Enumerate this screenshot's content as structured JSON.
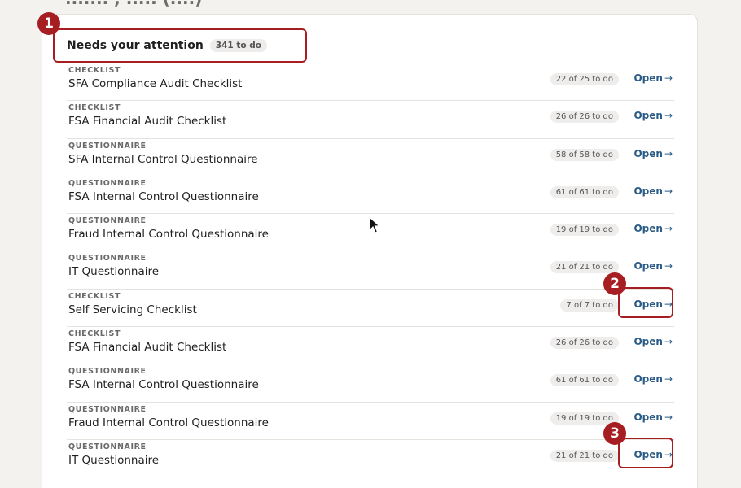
{
  "page": {
    "heading_cut": "....... , ..... (....)"
  },
  "section": {
    "title": "Needs your attention",
    "count_badge": "341 to do"
  },
  "open_label": "Open",
  "items": [
    {
      "type": "CHECKLIST",
      "name": "SFA Compliance Audit Checklist",
      "todo": "22 of 25 to do"
    },
    {
      "type": "CHECKLIST",
      "name": "FSA Financial Audit Checklist",
      "todo": "26 of 26 to do"
    },
    {
      "type": "QUESTIONNAIRE",
      "name": "SFA Internal Control Questionnaire",
      "todo": "58 of 58 to do"
    },
    {
      "type": "QUESTIONNAIRE",
      "name": "FSA Internal Control Questionnaire",
      "todo": "61 of 61 to do"
    },
    {
      "type": "QUESTIONNAIRE",
      "name": "Fraud Internal Control Questionnaire",
      "todo": "19 of 19 to do"
    },
    {
      "type": "QUESTIONNAIRE",
      "name": "IT Questionnaire",
      "todo": "21 of 21 to do"
    },
    {
      "type": "CHECKLIST",
      "name": "Self Servicing Checklist",
      "todo": "7 of 7 to do"
    },
    {
      "type": "CHECKLIST",
      "name": "FSA Financial Audit Checklist",
      "todo": "26 of 26 to do"
    },
    {
      "type": "QUESTIONNAIRE",
      "name": "FSA Internal Control Questionnaire",
      "todo": "61 of 61 to do"
    },
    {
      "type": "QUESTIONNAIRE",
      "name": "Fraud Internal Control Questionnaire",
      "todo": "19 of 19 to do"
    },
    {
      "type": "QUESTIONNAIRE",
      "name": "IT Questionnaire",
      "todo": "21 of 21 to do"
    }
  ],
  "annotations": {
    "m1": "1",
    "m2": "2",
    "m3": "3"
  },
  "colors": {
    "accent": "#a61e22",
    "link": "#2a5b86",
    "background": "#f4f2ef"
  }
}
